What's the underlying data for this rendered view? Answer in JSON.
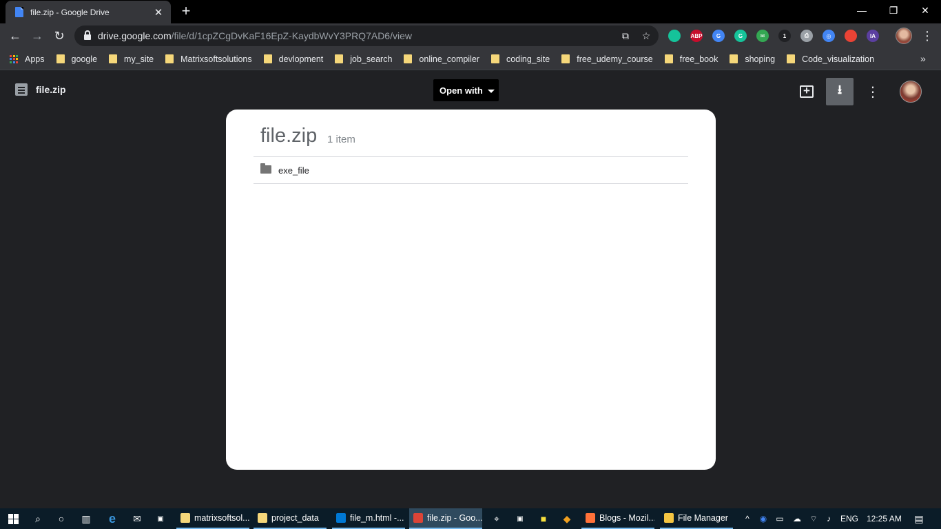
{
  "browser": {
    "tab_title": "file.zip - Google Drive",
    "tab_close": "✕",
    "new_tab": "+",
    "window_controls": {
      "minimize": "—",
      "restore": "❐",
      "close": "✕"
    },
    "nav": {
      "back": "←",
      "forward": "→",
      "reload": "↻"
    },
    "url_host": "drive.google.com",
    "url_path": "/file/d/1cpZCgDvKaF16EpZ-KaydbWvY3PRQ7AD6/view",
    "extensions": [
      {
        "name": "grammarly-extension-icon",
        "label": "",
        "color": "#15c39a"
      },
      {
        "name": "adblock-plus-icon",
        "label": "ABP",
        "color": "#c70d2c"
      },
      {
        "name": "google-translate-icon",
        "label": "G",
        "color": "#4285f4"
      },
      {
        "name": "grammarly-g-icon",
        "label": "G",
        "color": "#15c39a"
      },
      {
        "name": "mail-checker-icon",
        "label": "✉",
        "color": "#34a853"
      },
      {
        "name": "cube-extension-icon",
        "label": "1",
        "color": "#202124"
      },
      {
        "name": "printer-icon",
        "label": "⎙",
        "color": "#9aa0a6"
      },
      {
        "name": "compass-icon",
        "label": "◎",
        "color": "#4285f4"
      },
      {
        "name": "color-grid-icon",
        "label": "",
        "color": "#ea4335"
      },
      {
        "name": "ia-extension-icon",
        "label": "IA",
        "color": "#5b3fa0"
      }
    ],
    "bookmarks_more": "»"
  },
  "bookmarks": [
    {
      "label": "Apps",
      "type": "apps"
    },
    {
      "label": "google",
      "type": "folder"
    },
    {
      "label": "my_site",
      "type": "folder"
    },
    {
      "label": "Matrixsoftsolutions",
      "type": "folder"
    },
    {
      "label": "devlopment",
      "type": "folder"
    },
    {
      "label": "job_search",
      "type": "folder"
    },
    {
      "label": "online_compiler",
      "type": "folder"
    },
    {
      "label": "coding_site",
      "type": "folder"
    },
    {
      "label": "free_udemy_course",
      "type": "folder"
    },
    {
      "label": "free_book",
      "type": "folder"
    },
    {
      "label": "shoping",
      "type": "folder"
    },
    {
      "label": "Code_visualization",
      "type": "folder"
    }
  ],
  "viewer": {
    "file_name": "file.zip",
    "open_with_label": "Open with",
    "download_glyph": "⭳",
    "more_glyph": "⋮"
  },
  "archive": {
    "title": "file.zip",
    "count": "1 item",
    "items": [
      {
        "name": "exe_file",
        "type": "folder"
      }
    ]
  },
  "taskbar": {
    "apps": [
      {
        "label": "matrixsoftsol...",
        "icon_color": "#f5d77a",
        "active": false
      },
      {
        "label": "project_data",
        "icon_color": "#f5d77a",
        "active": false
      },
      {
        "label": "file_m.html -...",
        "icon_color": "#0078d4",
        "active": false
      },
      {
        "label": "file.zip - Goo...",
        "icon_color": "#db4437",
        "active": true
      },
      {
        "label": "Blogs - Mozil...",
        "icon_color": "#ff7139",
        "active": false
      },
      {
        "label": "File Manager",
        "icon_color": "#f5c542",
        "active": false
      }
    ],
    "language": "ENG",
    "time": "12:25 AM"
  },
  "colors": {
    "chrome_dark": "#35363a",
    "titlebar": "#000000",
    "viewer_bg": "#202124",
    "taskbar": "#0b1c28",
    "accent_blue": "#4285f4"
  }
}
